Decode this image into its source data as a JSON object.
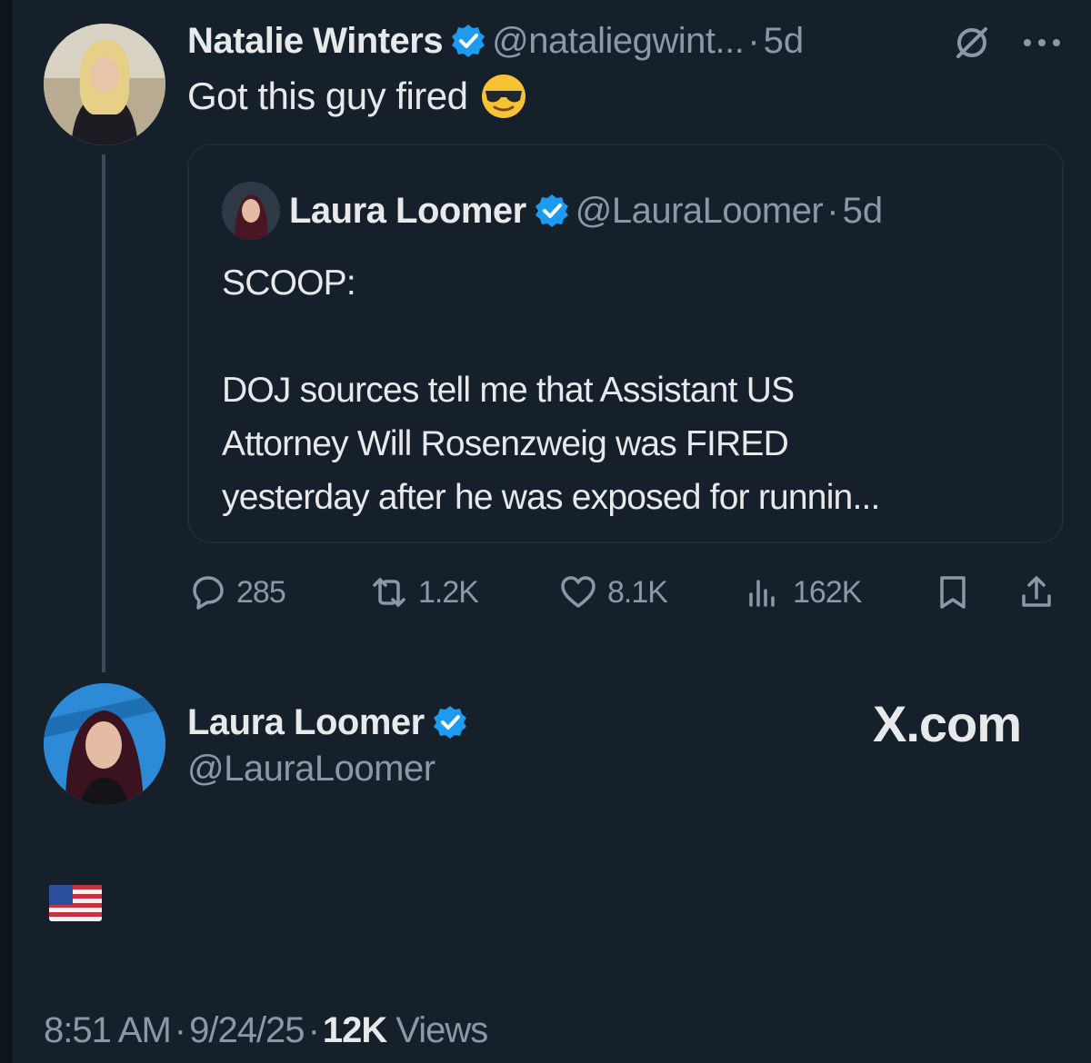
{
  "parent": {
    "author_name": "Natalie Winters",
    "handle": "@nataliegwint...",
    "separator": "·",
    "time": "5d",
    "text": "Got this guy fired",
    "avatar_icon": "profile-photo-natalie",
    "verified_color": "#1d9bf0"
  },
  "quote": {
    "author_name": "Laura Loomer",
    "handle": "@LauraLoomer",
    "separator": "·",
    "time": "5d",
    "line1": "SCOOP:",
    "line2": "DOJ sources tell me that Assistant US",
    "line3": "Attorney Will Rosenzweig was FIRED",
    "line4": "yesterday after he was exposed for runnin..."
  },
  "actions": {
    "replies": "285",
    "reposts": "1.2K",
    "likes": "8.1K",
    "views": "162K"
  },
  "reply": {
    "author_name": "Laura Loomer",
    "handle": "@LauraLoomer",
    "watermark": "X.com",
    "flag_icon": "us-flag-emoji"
  },
  "footer": {
    "time": "8:51 AM",
    "sep1": "·",
    "date": "9/24/25",
    "sep2": "·",
    "views_count": "12K",
    "views_label": "Views"
  },
  "colors": {
    "background": "#15202b",
    "text_primary": "#e7e9ea",
    "text_secondary": "#8b98a5",
    "accent": "#1d9bf0"
  }
}
